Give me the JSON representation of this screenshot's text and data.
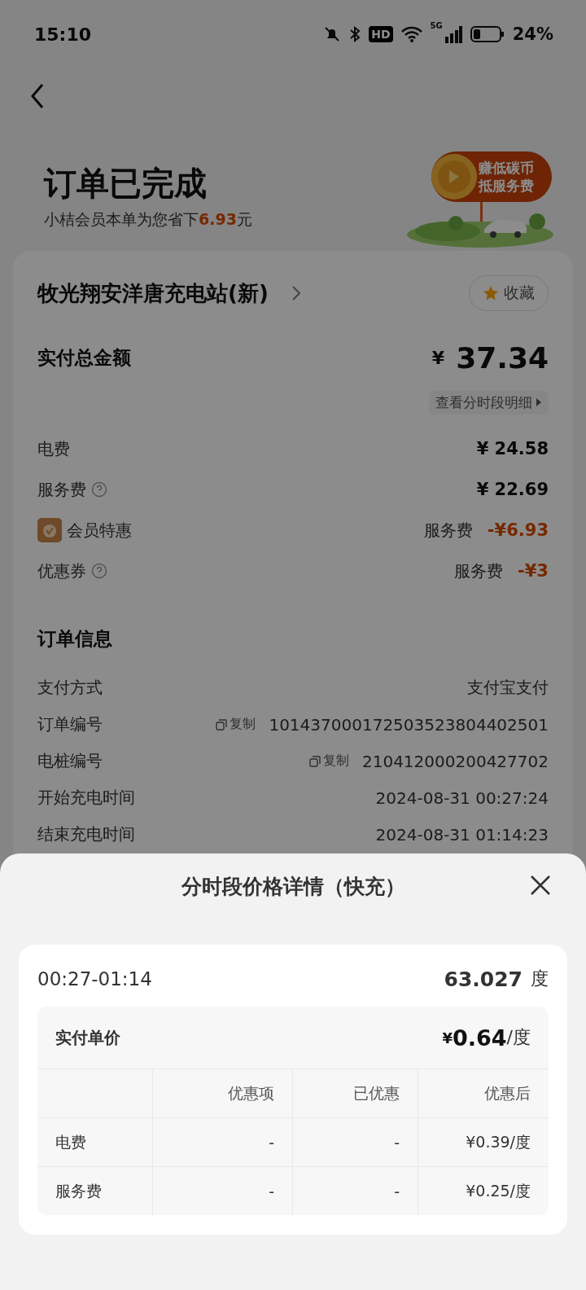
{
  "status_bar": {
    "time": "15:10",
    "hd_label": "HD",
    "network_label": "5G",
    "battery": "24%"
  },
  "header": {
    "title": "订单已完成",
    "savings_prefix": "小桔会员本单为您省下",
    "savings_amount": "6.93",
    "savings_suffix": "元"
  },
  "promo": {
    "lines": [
      "赚低碳币",
      "抵服务费"
    ]
  },
  "station": {
    "name": "牧光翔安洋唐充电站(新)",
    "favorite_label": "收藏"
  },
  "total": {
    "label": "实付总金额",
    "currency": "¥",
    "amount": "37.34",
    "detail_link": "查看分时段明细"
  },
  "fees": [
    {
      "kind": "amount",
      "label": "电费",
      "help": false,
      "value": "¥ 24.58"
    },
    {
      "kind": "amount",
      "label": "服务费",
      "help": true,
      "value": "¥ 22.69"
    },
    {
      "kind": "member_discount",
      "label": "会员特惠",
      "help": false,
      "note": "服务费",
      "value": "-¥6.93"
    },
    {
      "kind": "discount",
      "label": "优惠券",
      "help": true,
      "note": "服务费",
      "value": "-¥3"
    }
  ],
  "order_info": {
    "title": "订单信息",
    "rows": [
      {
        "label": "支付方式",
        "value": "支付宝支付"
      },
      {
        "label": "订单编号",
        "copy": "复制",
        "value": "101437000172503523804402501"
      },
      {
        "label": "电桩编号",
        "copy": "复制",
        "value": "210412000200427702"
      },
      {
        "label": "开始充电时间",
        "value": "2024-08-31 00:27:24"
      },
      {
        "label": "结束充电时间",
        "value": "2024-08-31 01:14:23"
      }
    ]
  },
  "sheet": {
    "title": "分时段价格详情（快充）",
    "period": {
      "time": "00:27-01:14",
      "energy": "63.027",
      "energy_unit": "度"
    },
    "unit_price": {
      "label": "实付单价",
      "currency": "¥",
      "amount": "0.64",
      "unit": "/度"
    },
    "table": {
      "columns": [
        "优惠项",
        "已优惠",
        "优惠后"
      ],
      "rows": [
        {
          "name": "电费",
          "cells": [
            "-",
            "-",
            "¥0.39/度"
          ]
        },
        {
          "name": "服务费",
          "cells": [
            "-",
            "-",
            "¥0.25/度"
          ]
        }
      ]
    }
  }
}
